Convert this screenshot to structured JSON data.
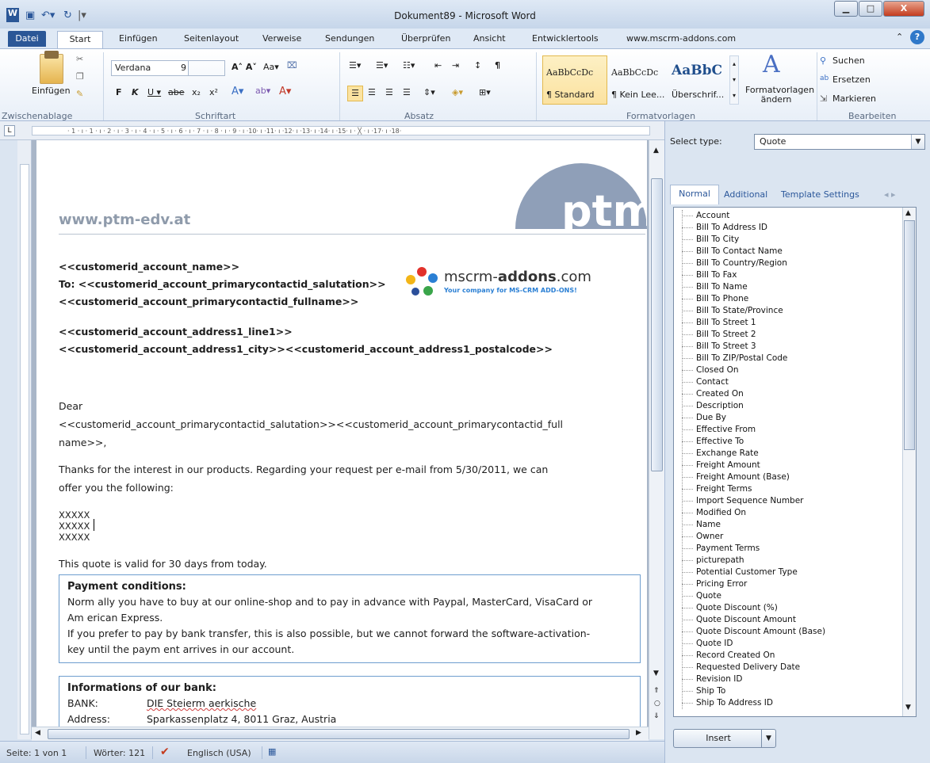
{
  "window": {
    "title": "Dokument89 - Microsoft Word",
    "minimize": "▁",
    "maximize": "□",
    "close": "X"
  },
  "tabs": {
    "datei": "Datei",
    "start": "Start",
    "einfuegen": "Einfügen",
    "seitenlayout": "Seitenlayout",
    "verweise": "Verweise",
    "sendungen": "Sendungen",
    "ueberpruefen": "Überprüfen",
    "ansicht": "Ansicht",
    "entwicklertools": "Entwicklertools",
    "addon": "www.mscrm-addons.com"
  },
  "ribbon": {
    "clipboard": {
      "label": "Zwischenablage",
      "paste": "Einfügen"
    },
    "font": {
      "label": "Schriftart",
      "name": "Verdana",
      "size": "9"
    },
    "paragraph": {
      "label": "Absatz"
    },
    "styles": {
      "label": "Formatvorlagen",
      "items": [
        {
          "sample": "AaBbCcDc",
          "name": "¶ Standard"
        },
        {
          "sample": "AaBbCcDc",
          "name": "¶ Kein Lee..."
        },
        {
          "sample": "AaBbC",
          "name": "Überschrif..."
        }
      ],
      "change": "Formatvorlagen ändern"
    },
    "editing": {
      "label": "Bearbeiten",
      "find": "Suchen",
      "replace": "Ersetzen",
      "select": "Markieren"
    }
  },
  "document": {
    "website": "www.ptm-edv.at",
    "ptm_logo": "ptm",
    "mscrm_logo_main": "mscrm-",
    "mscrm_logo_bold": "addons",
    "mscrm_logo_tail": ".com",
    "mscrm_tagline": "Your company for MS-CRM ADD-ONS!",
    "address_lines": [
      "<<customerid_account_name>>",
      "To: <<customerid_account_primarycontactid_salutation>>",
      "<<customerid_account_primarycontactid_fullname>>",
      "<<customerid_account_address1_line1>>",
      "<<customerid_account_address1_city>><<customerid_account_address1_postalcode>>"
    ],
    "dear": "Dear",
    "salutation_line1": "<<customerid_account_primarycontactid_salutation>><<customerid_account_primarycontactid_full",
    "salutation_line2": "name>>,",
    "thanks_line1": "Thanks for the interest in our products. Regarding your request per e-mail from 5/30/2011, we can",
    "thanks_line2": "offer you the following:",
    "placeholders": [
      "XXXXX",
      "XXXXX",
      "XXXXX"
    ],
    "validity": "This quote is valid for 30  days from today.",
    "payment": {
      "heading": "Payment conditions:",
      "lines": [
        "Norm ally you have to buy at our online-shop and to pay in advance with Paypal, MasterCard, VisaCard or",
        "Am erican Express.",
        "If you prefer to pay by bank transfer, this is also possible, but we cannot forward the software-activation-",
        "key until the paym ent arrives in our account."
      ]
    },
    "bank": {
      "heading": "Informations of our bank:",
      "rows": [
        {
          "label": "BANK:",
          "value": "DIE Steierm aerkische"
        },
        {
          "label": "Address:",
          "value": "Sparkassenplatz 4, 8011 Graz, Austria"
        }
      ]
    }
  },
  "ruler": {
    "numbers": "· 1 · ı · 1 · ı · 2 · ı · 3 · ı · 4 · ı · 5 · ı · 6 · ı · 7 · ı · 8 · ı · 9 · ı ·10· ı ·11· ı ·12· ı ·13· ı ·14· ı ·15· ı · ╳ · ı ·17· ı ·18·"
  },
  "status": {
    "page": "Seite: 1 von 1",
    "words": "Wörter: 121",
    "language": "Englisch (USA)"
  },
  "panel": {
    "select_type_label": "Select type:",
    "select_type_value": "Quote",
    "tabs": [
      "Normal",
      "Additional",
      "Template Settings"
    ],
    "fields": [
      "Account",
      "Bill To Address ID",
      "Bill To City",
      "Bill To Contact Name",
      "Bill To Country/Region",
      "Bill To Fax",
      "Bill To Name",
      "Bill To Phone",
      "Bill To State/Province",
      "Bill To Street 1",
      "Bill To Street 2",
      "Bill To Street 3",
      "Bill To ZIP/Postal Code",
      "Closed On",
      "Contact",
      "Created On",
      "Description",
      "Due By",
      "Effective From",
      "Effective To",
      "Exchange Rate",
      "Freight Amount",
      "Freight Amount (Base)",
      "Freight Terms",
      "Import Sequence Number",
      "Modified On",
      "Name",
      "Owner",
      "Payment Terms",
      "picturepath",
      "Potential Customer Type",
      "Pricing Error",
      "Quote",
      "Quote Discount (%)",
      "Quote Discount Amount",
      "Quote Discount Amount (Base)",
      "Quote ID",
      "Record Created On",
      "Requested Delivery Date",
      "Revision ID",
      "Ship To",
      "Ship To Address ID"
    ],
    "insert": "Insert"
  },
  "colors": {
    "accent": "#2b5797",
    "ribbon_bg": "#e8eff8",
    "link_box": "#6e9ecf"
  }
}
